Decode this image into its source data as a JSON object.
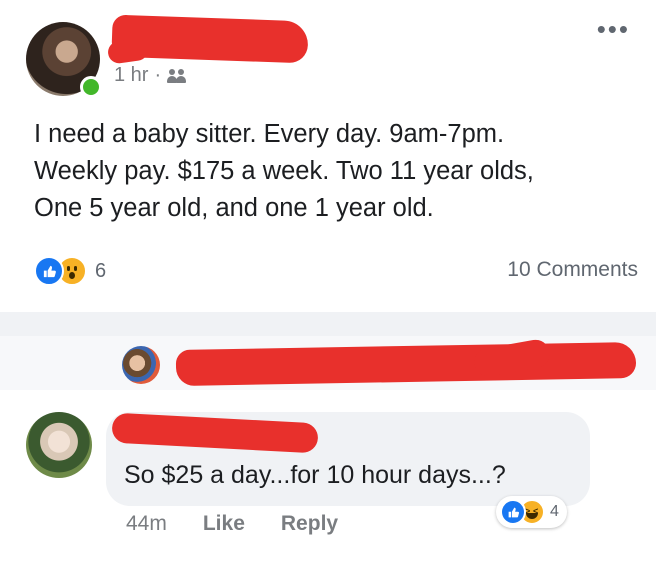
{
  "post": {
    "time": "1 hr",
    "separator": "·",
    "more_icon": "more-horizontal-icon",
    "text": "I need a baby sitter. Every day. 9am-7pm. Weekly pay. $175 a week. Two 11 year olds, One 5 year old, and one 1 year old.",
    "text_lines": [
      "I need a baby sitter. Every day. 9am-7pm.",
      "Weekly pay. $175 a week. Two 11 year olds,",
      "One 5 year old, and one 1 year old."
    ],
    "reactions": [
      "like",
      "wow"
    ],
    "reaction_count": "6",
    "comments_count": "10 Comments"
  },
  "comment": {
    "text": "So $25 a day...for 10 hour days...?",
    "time": "44m",
    "like_label": "Like",
    "reply_label": "Reply",
    "reactions": [
      "like",
      "haha"
    ],
    "reaction_count": "4"
  },
  "colors": {
    "redaction": "#e8302c",
    "like_blue": "#1877f2",
    "emoji_yellow": "#f7b125",
    "online_green": "#42b72a",
    "bubble_bg": "#f0f2f5"
  }
}
